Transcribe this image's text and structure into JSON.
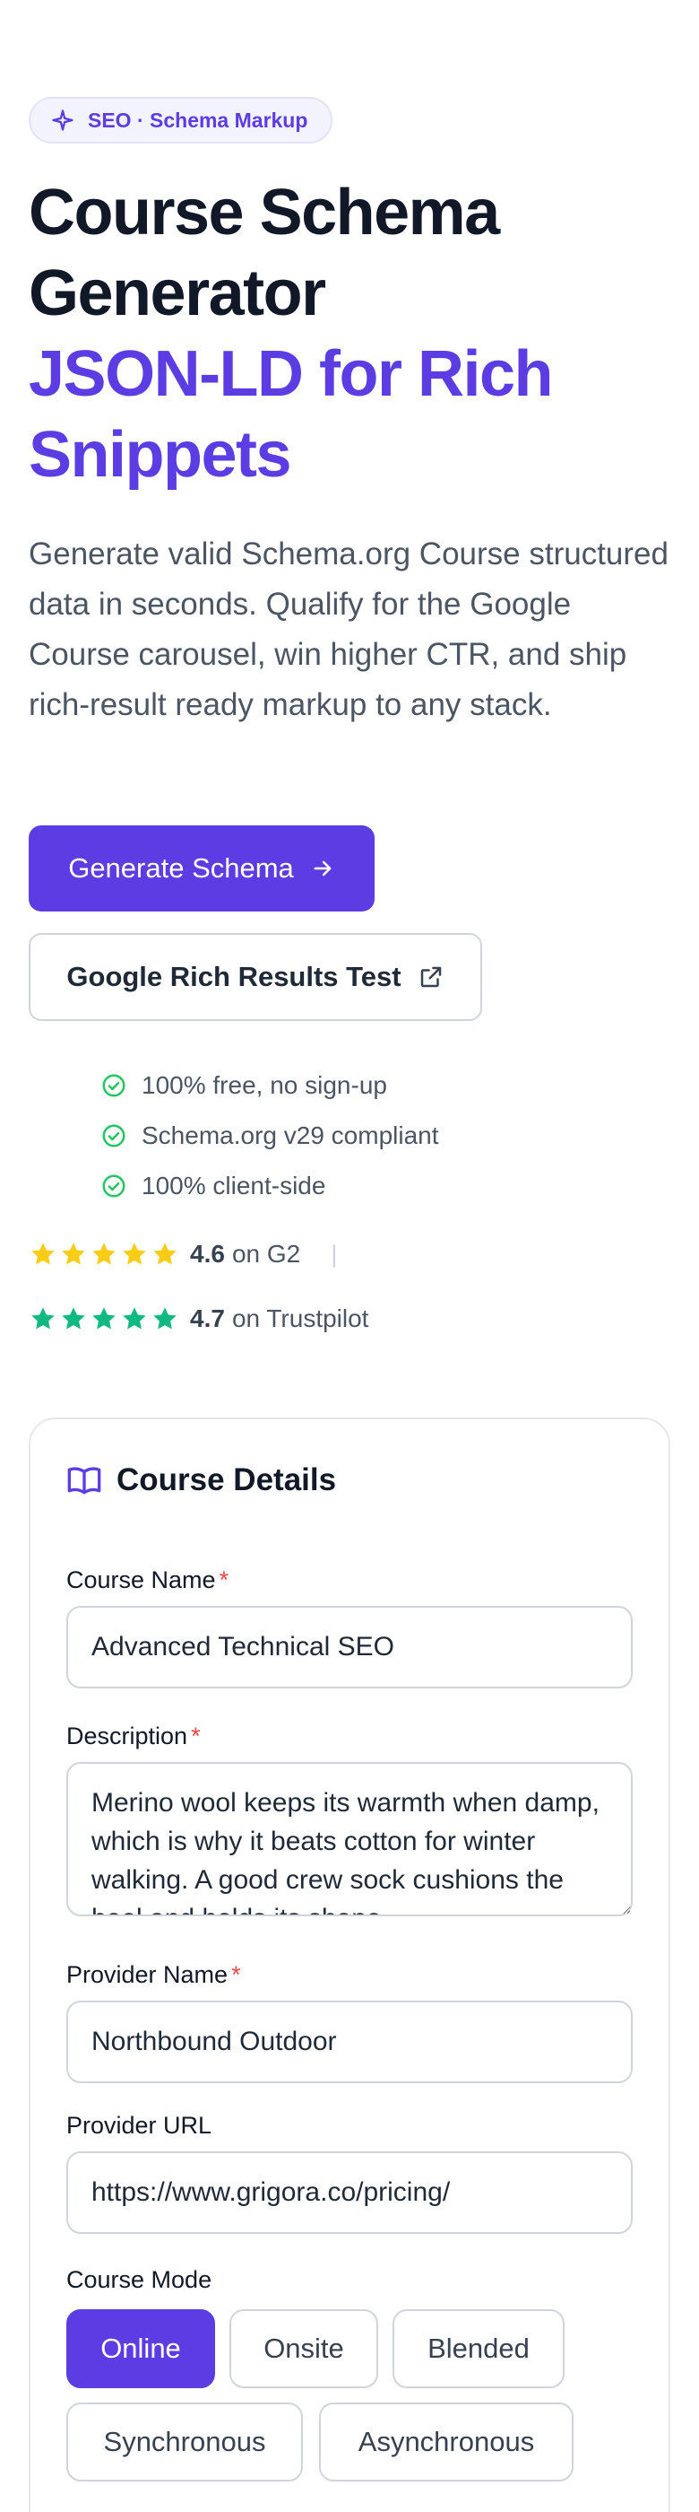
{
  "hero": {
    "badge": "SEO · Schema Markup",
    "title_line1": "Course Schema Generator",
    "title_line2": "JSON-LD for Rich Snippets",
    "lead": "Generate valid Schema.org Course structured data in seconds. Qualify for the Google Course carousel, win higher CTR, and ship rich-result ready markup to any stack.",
    "primary_cta": "Generate Schema",
    "secondary_cta": "Google Rich Results Test"
  },
  "checks": [
    "100% free, no sign-up",
    "Schema.org v29 compliant",
    "100% client-side"
  ],
  "ratings": [
    {
      "score": "4.6",
      "source": "on G2",
      "stars": 5,
      "color": "#facc15"
    },
    {
      "score": "4.7",
      "source": "on Trustpilot",
      "stars": 5,
      "color": "#10b981"
    }
  ],
  "form": {
    "title": "Course Details",
    "course_name_label": "Course Name",
    "course_name_value": "Advanced Technical SEO",
    "description_label": "Description",
    "description_value": "Merino wool keeps its warmth when damp, which is why it beats cotton for winter walking. A good crew sock cushions the heel and holds its shape.",
    "provider_name_label": "Provider Name",
    "provider_name_value": "Northbound Outdoor",
    "provider_url_label": "Provider URL",
    "provider_url_value": "https://www.grigora.co/pricing/",
    "required_mark": "*",
    "course_mode_label": "Course Mode",
    "modes": [
      {
        "label": "Online",
        "active": true
      },
      {
        "label": "Onsite",
        "active": false
      },
      {
        "label": "Blended",
        "active": false
      },
      {
        "label": "Synchronous",
        "active": false
      },
      {
        "label": "Asynchronous",
        "active": false
      }
    ]
  },
  "colors": {
    "accent": "#5b3de3",
    "check": "#22c55e",
    "required": "#ef4444"
  }
}
